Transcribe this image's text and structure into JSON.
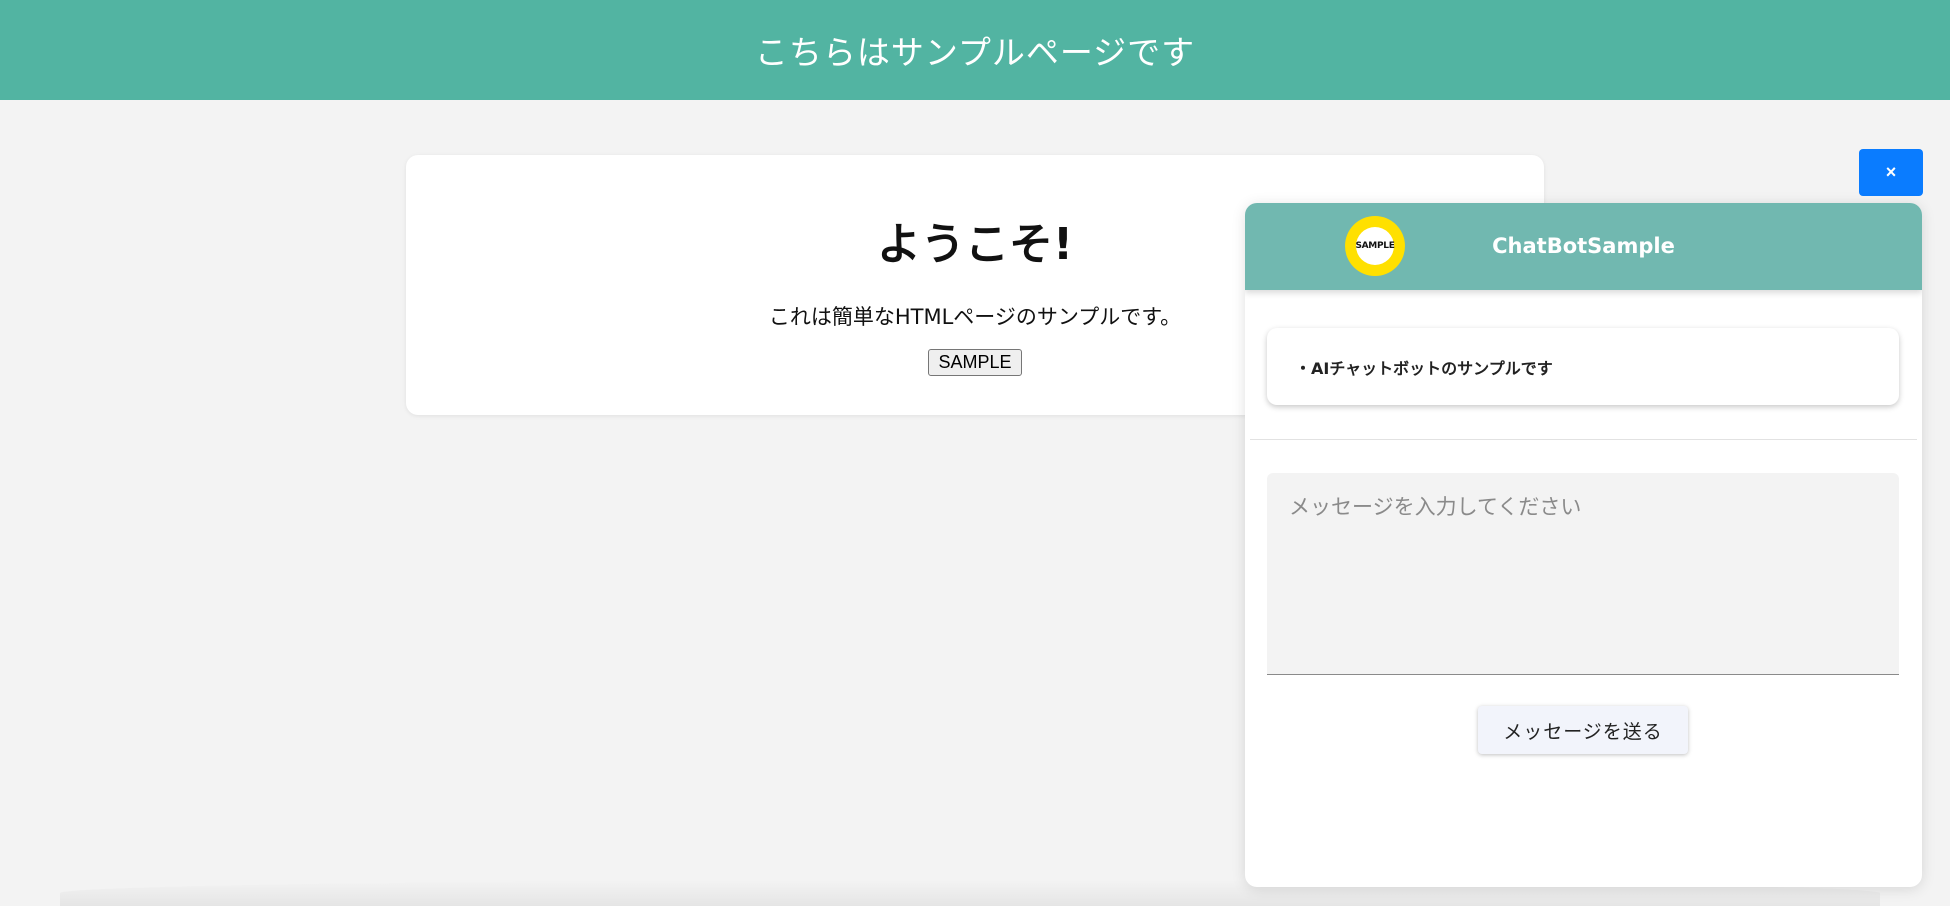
{
  "page": {
    "header_title": "こちらはサンプルページです"
  },
  "welcome": {
    "heading": "ようこそ!",
    "description": "これは簡単なHTMLページのサンプルです。",
    "sample_button_label": "SAMPLE"
  },
  "close_button": {
    "label": "×"
  },
  "chatbot": {
    "logo_text": "SAMPLE",
    "title": "ChatBotSample",
    "messages": [
      {
        "text": "・AIチャットボットのサンプルです"
      }
    ],
    "input_placeholder": "メッセージを入力してください",
    "input_value": "",
    "send_button_label": "メッセージを送る"
  },
  "colors": {
    "header_bg": "#52b4a2",
    "chat_header_bg": "#71b8b0",
    "close_button_bg": "#0a7cff",
    "logo_yellow": "#ffe000",
    "page_bg": "#f3f3f3"
  }
}
